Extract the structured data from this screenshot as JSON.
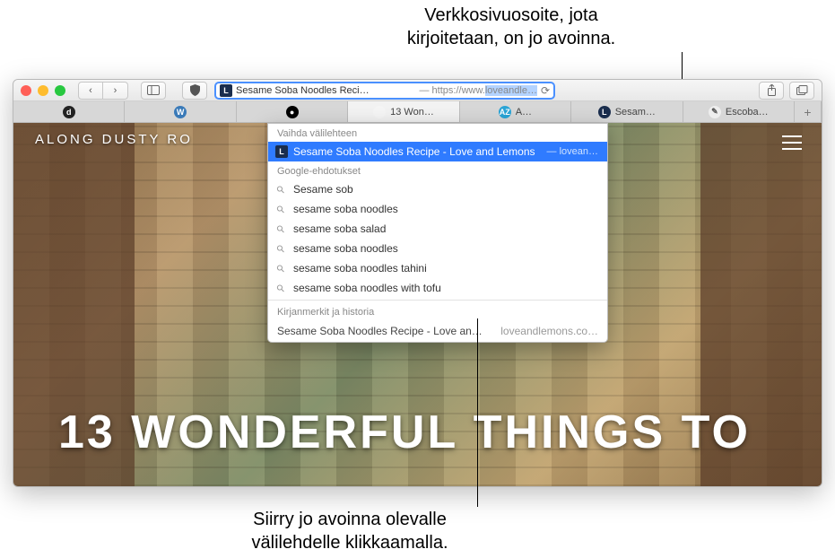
{
  "annotations": {
    "top": "Verkkosivuosoite, jota\nkirjoitetaan, on jo avoinna.",
    "bottom": "Siirry jo avoinna olevalle\nvälilehdelle klikkaamalla."
  },
  "address_bar": {
    "typed_title": "Sesame Soba Noodles Reci…",
    "separator": " — ",
    "url_prefix": "https://www.",
    "url_selected": "loveandle…",
    "favicon_letter": "L"
  },
  "tabs": [
    {
      "label": "",
      "fav_bg": "#222",
      "fav_fg": "#fff",
      "fav_text": "d"
    },
    {
      "label": "",
      "fav_bg": "#3a7ab8",
      "fav_fg": "#fff",
      "fav_text": "W"
    },
    {
      "label": "",
      "fav_bg": "#000",
      "fav_fg": "#fff",
      "fav_text": "●"
    },
    {
      "label": "13 Won…",
      "fav_bg": "#f5f5f5",
      "fav_fg": "#333",
      "fav_text": "",
      "active": true
    },
    {
      "label": "A…",
      "fav_bg": "#2aa4d6",
      "fav_fg": "#fff",
      "fav_text": "AZ"
    },
    {
      "label": "Sesam…",
      "fav_bg": "#1a2d4d",
      "fav_fg": "#fff",
      "fav_text": "L"
    },
    {
      "label": "Escoba…",
      "fav_bg": "#eee",
      "fav_fg": "#555",
      "fav_text": "✎"
    }
  ],
  "dropdown": {
    "switch_label": "Vaihda välilehteen",
    "switch_item": {
      "title": "Sesame Soba Noodles Recipe - Love and Lemons",
      "trail": "— lovean…",
      "favicon_letter": "L"
    },
    "google_label": "Google-ehdotukset",
    "suggestions": [
      "Sesame sob",
      "sesame soba noodles",
      "sesame soba salad",
      "sesame soba noodles",
      "sesame soba noodles tahini",
      "sesame soba noodles with tofu"
    ],
    "bookmarks_label": "Kirjanmerkit ja historia",
    "bookmark_item": {
      "title": "Sesame Soba Noodles Recipe - Love an…",
      "domain": "loveandlemons.co…"
    }
  },
  "page": {
    "small_heading": "ALONG DUSTY RO",
    "big_heading": "13 WONDERFUL THINGS TO"
  }
}
